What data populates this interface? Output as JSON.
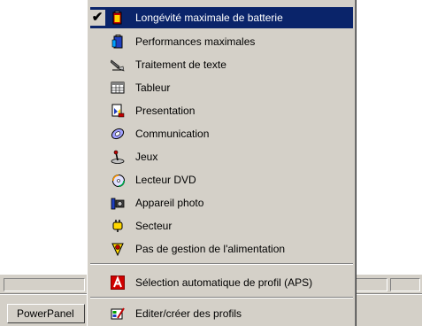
{
  "taskbar": {
    "button_label": "PowerPanel"
  },
  "menu": {
    "items": [
      {
        "label": "Longévité maximale de batterie",
        "icon": "battery-icon",
        "checked": true,
        "selected": true
      },
      {
        "label": "Performances maximales",
        "icon": "performance-icon"
      },
      {
        "label": "Traitement de texte",
        "icon": "word-processing-icon"
      },
      {
        "label": "Tableur",
        "icon": "spreadsheet-icon"
      },
      {
        "label": "Presentation",
        "icon": "presentation-icon"
      },
      {
        "label": "Communication",
        "icon": "communication-icon"
      },
      {
        "label": "Jeux",
        "icon": "joystick-icon"
      },
      {
        "label": "Lecteur DVD",
        "icon": "dvd-icon"
      },
      {
        "label": "Appareil photo",
        "icon": "camera-icon"
      },
      {
        "label": "Secteur",
        "icon": "ac-power-icon"
      },
      {
        "label": "Pas de gestion de l'alimentation",
        "icon": "no-power-management-icon"
      },
      {
        "label": "Sélection automatique de profil (APS)",
        "icon": "aps-icon"
      },
      {
        "label": "Editer/créer des profils",
        "icon": "edit-profiles-icon"
      }
    ],
    "check_mark": "✔"
  },
  "colors": {
    "menu_bg": "#d4d0c8",
    "highlight": "#0a246a",
    "highlight_text": "#ffffff"
  }
}
